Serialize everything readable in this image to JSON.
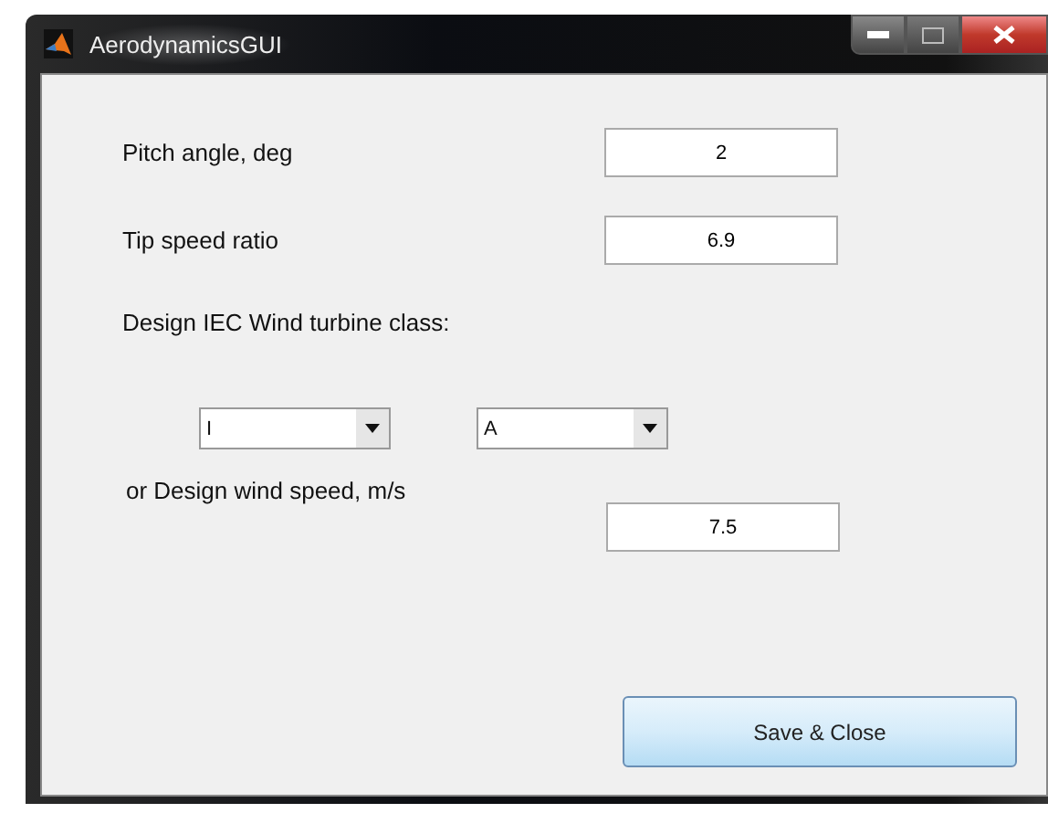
{
  "window": {
    "title": "AerodynamicsGUI"
  },
  "fields": [
    {
      "label": "Pitch angle, deg",
      "value": "2"
    },
    {
      "label": "Tip speed ratio",
      "value": "6.9"
    }
  ],
  "class_heading": "Design IEC Wind turbine class:",
  "dropdowns": [
    {
      "value": "I"
    },
    {
      "value": "A"
    }
  ],
  "wind_speed": {
    "label": "or Design wind speed, m/s",
    "value": "7.5"
  },
  "buttons": [
    "Save & Close"
  ]
}
